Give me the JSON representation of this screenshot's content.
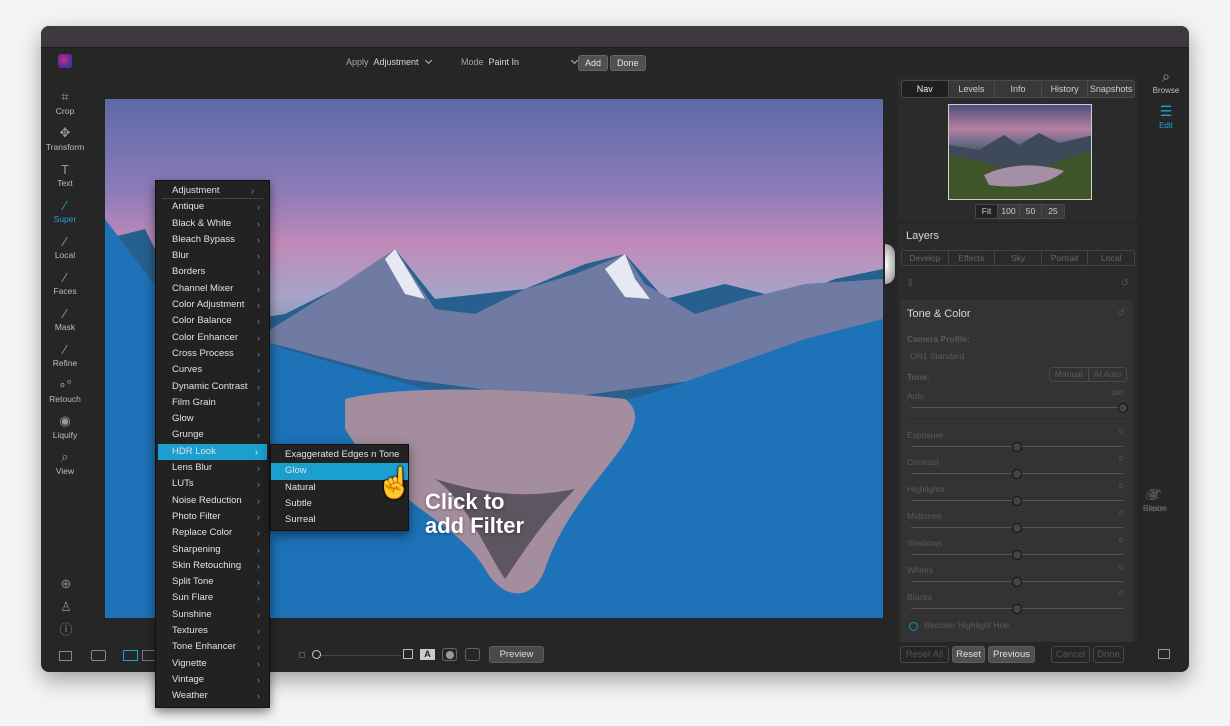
{
  "topbar": {
    "apply_label": "Apply",
    "apply_value": "Adjustment",
    "mode_label": "Mode",
    "mode_value": "Paint In",
    "add_button": "Add",
    "done_button": "Done"
  },
  "tools": [
    {
      "label": "Crop",
      "icon": "crop-icon",
      "glyph": "⌗"
    },
    {
      "label": "Transform",
      "icon": "move-icon",
      "glyph": "✥"
    },
    {
      "label": "Text",
      "icon": "text-icon",
      "glyph": "T"
    },
    {
      "label": "Super",
      "icon": "magic-wand-icon",
      "glyph": "⁄",
      "active": true
    },
    {
      "label": "Local",
      "icon": "local-brush-icon",
      "glyph": "⁄"
    },
    {
      "label": "Faces",
      "icon": "face-brush-icon",
      "glyph": "⁄"
    },
    {
      "label": "Mask",
      "icon": "mask-brush-icon",
      "glyph": "⁄"
    },
    {
      "label": "Refine",
      "icon": "refine-brush-icon",
      "glyph": "⁄"
    },
    {
      "label": "Retouch",
      "icon": "retouch-icon",
      "glyph": "∘°"
    },
    {
      "label": "Liquify",
      "icon": "liquify-icon",
      "glyph": "◉"
    },
    {
      "label": "View",
      "icon": "view-hand-icon",
      "glyph": "⌕"
    }
  ],
  "filter_menu": {
    "items": [
      "Adjustment",
      "Antique",
      "Black & White",
      "Bleach Bypass",
      "Blur",
      "Borders",
      "Channel Mixer",
      "Color Adjustment",
      "Color Balance",
      "Color Enhancer",
      "Cross Process",
      "Curves",
      "Dynamic Contrast",
      "Film Grain",
      "Glow",
      "Grunge",
      "HDR Look",
      "Lens Blur",
      "LUTs",
      "Noise Reduction",
      "Photo Filter",
      "Replace Color",
      "Sharpening",
      "Skin Retouching",
      "Split Tone",
      "Sun Flare",
      "Sunshine",
      "Textures",
      "Tone Enhancer",
      "Vignette",
      "Vintage",
      "Weather"
    ],
    "selected": "HDR Look",
    "submenu": {
      "items": [
        "Exaggerated Edges n Tone",
        "Glow",
        "Natural",
        "Subtle",
        "Surreal"
      ],
      "selected": "Glow"
    }
  },
  "callout": {
    "line1": "Click to",
    "line2": "add Filter"
  },
  "bottombar": {
    "preview_button": "Preview"
  },
  "right_panel": {
    "nav_tabs": [
      "Nav",
      "Levels",
      "Info",
      "History",
      "Snapshots"
    ],
    "nav_active": "Nav",
    "zoom_options": [
      "Fit",
      "100",
      "50",
      "25"
    ],
    "zoom_active": "Fit",
    "layers_title": "Layers",
    "layer_tabs": [
      "Develop",
      "Effects",
      "Sky",
      "Portrait",
      "Local"
    ],
    "tone_title": "Tone & Color",
    "camera_profile_label": "Camera Profile:",
    "camera_profile_value": "ON1 Standard",
    "tone_label": "Tone:",
    "tone_modes": [
      "Manual",
      "AI Auto"
    ],
    "auto": {
      "label": "Auto",
      "value": "100",
      "fraction": 1.0
    },
    "sliders": [
      {
        "label": "Exposure",
        "value": "0",
        "fraction": 0.5
      },
      {
        "label": "Contrast",
        "value": "0",
        "fraction": 0.5
      },
      {
        "label": "Highlights",
        "value": "0",
        "fraction": 0.5
      },
      {
        "label": "Midtones",
        "value": "0",
        "fraction": 0.5
      },
      {
        "label": "Shadows",
        "value": "0",
        "fraction": 0.5
      },
      {
        "label": "Whites",
        "value": "0",
        "fraction": 0.5
      },
      {
        "label": "Blacks",
        "value": "0",
        "fraction": 0.5
      }
    ],
    "recover_label": "Recover Highlight Hue",
    "buttons": {
      "reset_all": "Reset All",
      "reset": "Reset",
      "previous": "Previous",
      "cancel": "Cancel",
      "done": "Done"
    }
  },
  "far_right": {
    "top": [
      {
        "label": "Browse",
        "icon": "browse-icon",
        "glyph": "⌕"
      },
      {
        "label": "Edit",
        "icon": "edit-sliders-icon",
        "glyph": "☰",
        "active": true
      }
    ],
    "bottom": [
      {
        "label": "Resize",
        "icon": "resize-icon",
        "glyph": "⤢"
      },
      {
        "label": "Print",
        "icon": "print-icon",
        "glyph": "⎙"
      },
      {
        "label": "Share",
        "icon": "share-icon",
        "glyph": "⋖"
      },
      {
        "label": "Export",
        "icon": "export-icon",
        "glyph": "⇪"
      }
    ]
  },
  "colors": {
    "accent": "#1ba3d6",
    "menu_highlight": "#1a9fcf",
    "window_bg": "#262626"
  }
}
